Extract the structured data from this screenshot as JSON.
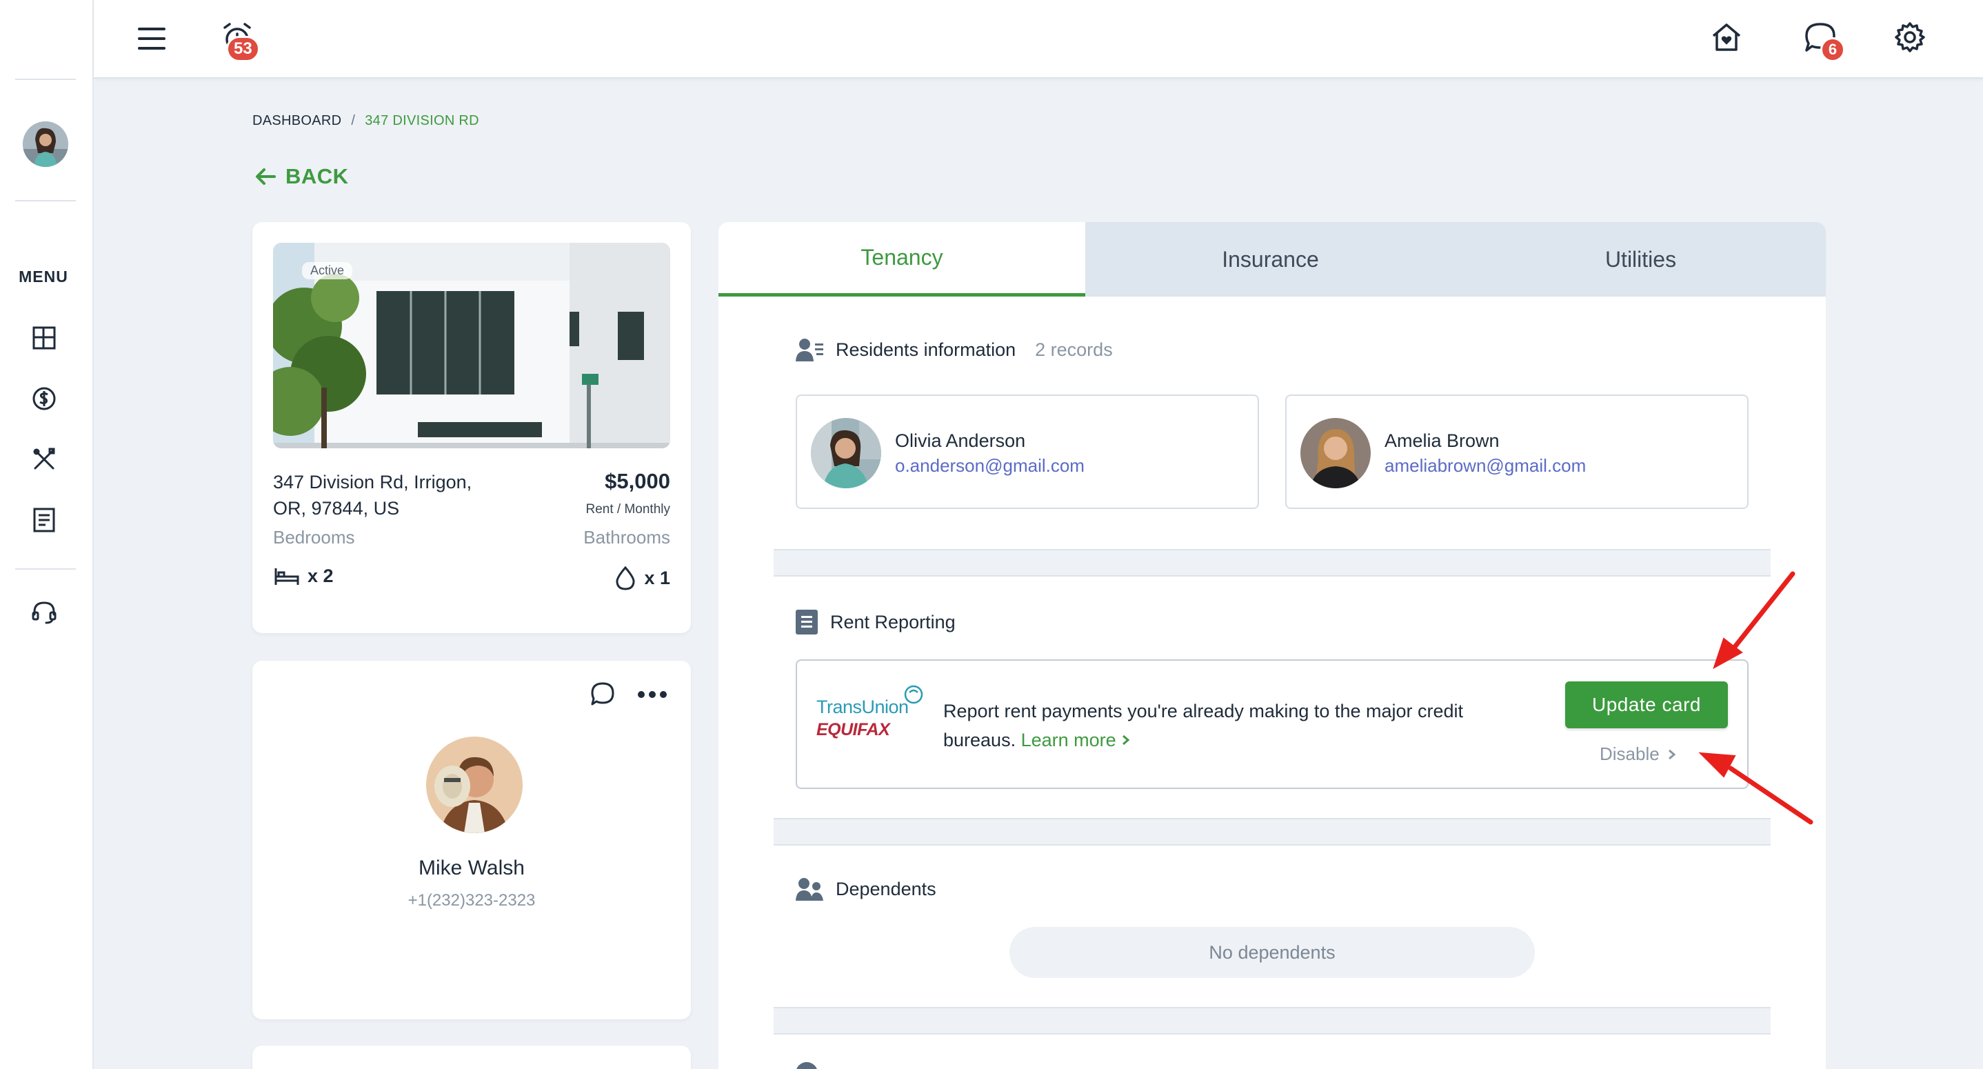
{
  "topbar": {
    "alarm_badge": "53",
    "chat_badge": "6"
  },
  "sidebar": {
    "menu_label": "MENU"
  },
  "breadcrumb": {
    "root": "DASHBOARD",
    "separator": "/",
    "current": "347 DIVISION RD"
  },
  "back_label": "BACK",
  "property": {
    "status_label": "Active",
    "address_line1": "347 Division Rd, Irrigon,",
    "address_line2": "OR, 97844, US",
    "price": "$5,000",
    "period": "Rent / Monthly",
    "bedrooms_label": "Bedrooms",
    "bedrooms_value": "x 2",
    "bathrooms_label": "Bathrooms",
    "bathrooms_value": "x 1"
  },
  "agent": {
    "name": "Mike Walsh",
    "phone": "+1(232)323-2323"
  },
  "tabs": [
    {
      "label": "Tenancy",
      "active": true
    },
    {
      "label": "Insurance",
      "active": false
    },
    {
      "label": "Utilities",
      "active": false
    }
  ],
  "residents": {
    "title": "Residents information",
    "count": "2 records",
    "items": [
      {
        "name": "Olivia Anderson",
        "email": "o.anderson@gmail.com"
      },
      {
        "name": "Amelia Brown",
        "email": "ameliabrown@gmail.com"
      }
    ]
  },
  "rent_reporting": {
    "title": "Rent Reporting",
    "logo_top": "TransUnion",
    "logo_bottom": "EQUIFAX",
    "text": "Report rent payments you're already making to the major credit bureaus.",
    "learn_more": "Learn more",
    "update_button": "Update card",
    "disable_label": "Disable"
  },
  "dependents": {
    "title": "Dependents",
    "empty": "No dependents"
  },
  "colors": {
    "accent_green": "#3d9a3f",
    "badge_red": "#e04a3f",
    "link_blue": "#5b6bc6",
    "annotation_red": "#e8201c"
  }
}
